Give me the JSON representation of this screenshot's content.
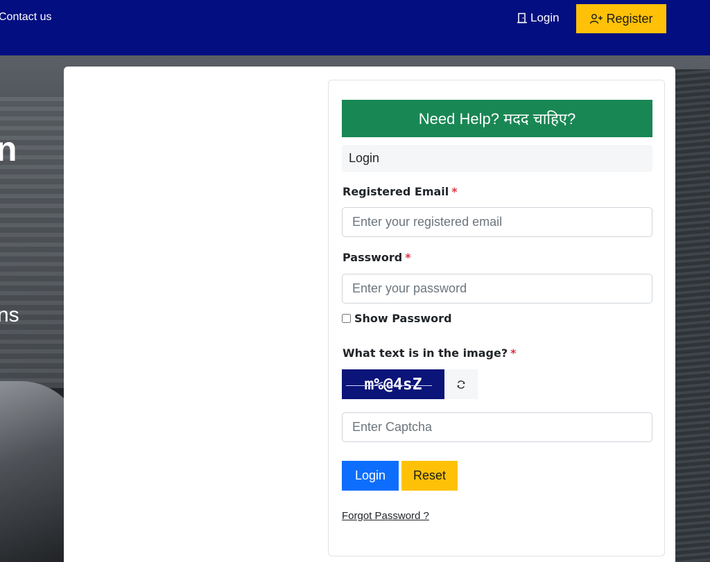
{
  "nav": {
    "contact_label": "Contact us",
    "login_label": "Login",
    "register_label": "Register",
    "login_icon": "door-icon",
    "register_icon": "add-user-icon"
  },
  "hero": {
    "fragment_1": "n",
    "fragment_2": "ns"
  },
  "login_panel": {
    "help_banner": "Need Help? मदद चाहिए?",
    "heading": "Login",
    "email": {
      "label": "Registered Email",
      "required_mark": "*",
      "placeholder": "Enter your registered email",
      "value": ""
    },
    "password": {
      "label": "Password",
      "required_mark": "*",
      "placeholder": "Enter your password",
      "value": ""
    },
    "show_password_label": "Show Password",
    "show_password_checked": false,
    "captcha": {
      "label": "What text is in the image?",
      "required_mark": "*",
      "image_text": "m%@4sZ",
      "refresh_icon": "refresh-icon",
      "placeholder": "Enter Captcha",
      "value": ""
    },
    "login_button": "Login",
    "reset_button": "Reset",
    "forgot_password": "Forgot Password ?"
  },
  "colors": {
    "navbar": "#030f80",
    "register_button": "#ffc107",
    "help_banner": "#198754",
    "login_button": "#0d6efd",
    "reset_button": "#ffc107",
    "captcha_bg": "#0b1478",
    "required": "#dc3545"
  }
}
